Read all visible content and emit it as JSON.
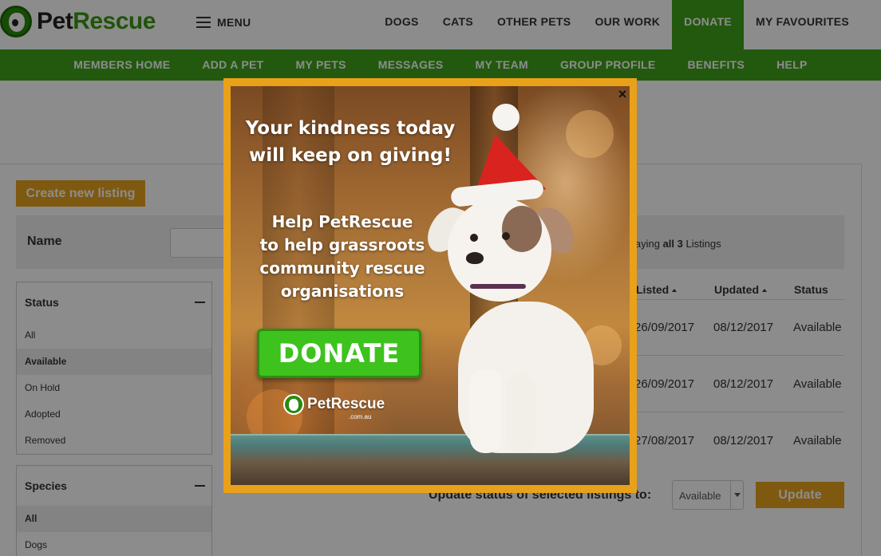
{
  "brand": {
    "name_part1": "Pet",
    "name_part2": "Rescue"
  },
  "header": {
    "menu_label": "MENU",
    "nav": [
      "DOGS",
      "CATS",
      "OTHER PETS",
      "OUR WORK",
      "DONATE",
      "MY FAVOURITES"
    ]
  },
  "subnav": [
    "MEMBERS HOME",
    "ADD A PET",
    "MY PETS",
    "MESSAGES",
    "MY TEAM",
    "GROUP PROFILE",
    "BENEFITS",
    "HELP"
  ],
  "listings": {
    "create_label": "Create new listing",
    "name_label": "Name",
    "count_prefix": "…laying ",
    "count_bold": "all 3",
    "count_suffix": " Listings",
    "columns": [
      "Listed",
      "Updated",
      "Status"
    ],
    "rows": [
      {
        "listed": "26/09/2017",
        "updated": "08/12/2017",
        "status": "Available"
      },
      {
        "listed": "26/09/2017",
        "updated": "08/12/2017",
        "status": "Available"
      },
      {
        "listed": "27/08/2017",
        "updated": "08/12/2017",
        "status": "Available"
      }
    ],
    "update_label": "Update status of selected listings to:",
    "update_select_value": "Available",
    "update_button": "Update"
  },
  "filters": {
    "status": {
      "title": "Status",
      "items": [
        "All",
        "Available",
        "On Hold",
        "Adopted",
        "Removed"
      ],
      "selected": "Available"
    },
    "species": {
      "title": "Species",
      "items": [
        "All",
        "Dogs"
      ],
      "selected": "All"
    }
  },
  "modal": {
    "headline_line1": "Your kindness today",
    "headline_line2": "will keep on giving!",
    "sub_line1": "Help PetRescue",
    "sub_line2": "to help grassroots",
    "sub_line3": "community rescue",
    "sub_line4": "organisations",
    "donate_label": "DONATE",
    "logo_text": "PetRescue",
    "logo_domain": ".com.au",
    "close_glyph": "×"
  },
  "colors": {
    "brand_green": "#3ea31b",
    "accent_orange": "#e8a21c"
  }
}
